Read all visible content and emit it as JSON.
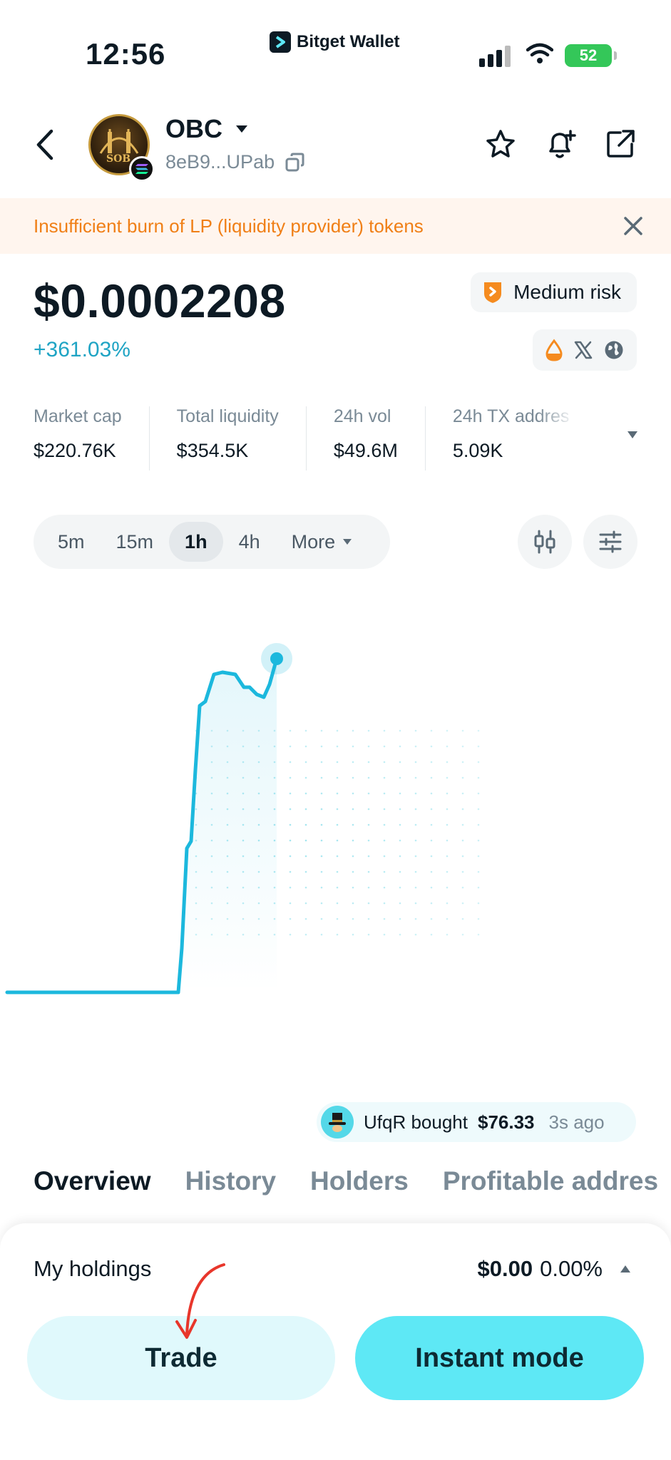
{
  "status": {
    "time": "12:56",
    "app_name": "Bitget Wallet",
    "battery": "52"
  },
  "token": {
    "avatar_label": "SOB",
    "name": "OBC",
    "address": "8eB9...UPab"
  },
  "warning": {
    "text": "Insufficient burn of LP (liquidity provider) tokens"
  },
  "price": {
    "value": "$0.0002208",
    "change": "+361.03%",
    "risk": "Medium risk"
  },
  "stats": [
    {
      "label": "Market cap",
      "value": "$220.76K"
    },
    {
      "label": "Total liquidity",
      "value": "$354.5K"
    },
    {
      "label": "24h vol",
      "value": "$49.6M"
    },
    {
      "label": "24h TX addres",
      "value": "5.09K"
    }
  ],
  "intervals": {
    "items": [
      "5m",
      "15m",
      "1h",
      "4h"
    ],
    "active": "1h",
    "more": "More"
  },
  "ticker": {
    "user": "UfqR bought",
    "amount": "$76.33",
    "ago": "3s ago"
  },
  "tabs": [
    "Overview",
    "History",
    "Holders",
    "Profitable addres"
  ],
  "holdings": {
    "label": "My holdings",
    "value": "$0.00",
    "percent": "0.00%"
  },
  "actions": {
    "trade": "Trade",
    "instant": "Instant mode"
  },
  "colors": {
    "accent": "#1cb8dd",
    "warning": "#f07f16",
    "risk": "#f58b1f",
    "positive": "#1fa4c4"
  }
}
